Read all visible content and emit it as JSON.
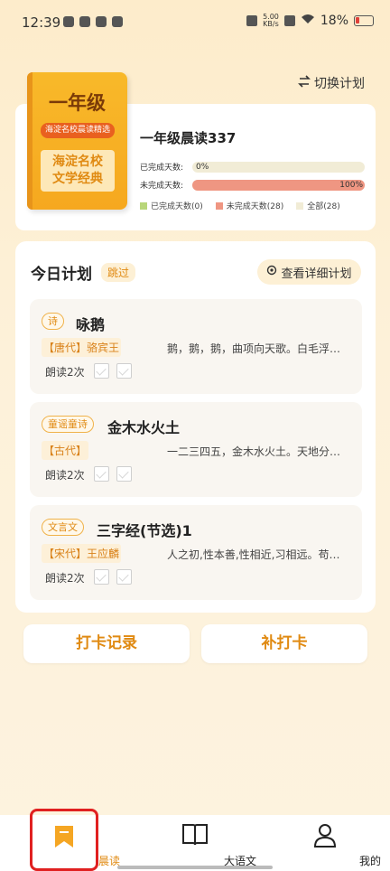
{
  "status_bar": {
    "time": "12:39",
    "speed_top": "5.00",
    "speed_bottom": "KB/s",
    "battery": "18%"
  },
  "header": {
    "switch_plan": "切换计划"
  },
  "plan": {
    "cover_title": "一年级",
    "cover_badge": "海淀名校晨读精选",
    "cover_line1": "海淀名校",
    "cover_line2": "文学经典",
    "title": "一年级晨读337",
    "completed_label": "已完成天数:",
    "completed_value": "0%",
    "completed_fraction": 0,
    "uncompleted_label": "未完成天数:",
    "uncompleted_value": "100%",
    "uncompleted_fraction": 1.0,
    "legend": [
      {
        "label": "已完成天数(0)",
        "color": "#b8d67a"
      },
      {
        "label": "未完成天数(28)",
        "color": "#ef9682"
      },
      {
        "label": "全部(28)",
        "color": "#f1ecd6"
      }
    ]
  },
  "today": {
    "title": "今日计划",
    "skip": "跳过",
    "detail": "查看详细计划",
    "read_label": "朗读2次",
    "items": [
      {
        "tag": "诗",
        "title": "咏鹅",
        "author": "【唐代】骆宾王",
        "excerpt": "鹅，鹅，鹅，曲项向天歌。白毛浮绿水，红掌拨清波。"
      },
      {
        "tag": "童谣童诗",
        "title": "金木水火土",
        "author": "【古代】",
        "excerpt": "一二三四五，金木水火土。天地分上下，日月照今古。"
      },
      {
        "tag": "文言文",
        "title": "三字经(节选)1",
        "author": "【宋代】王应麟",
        "excerpt": "人之初,性本善,性相近,习相远。苟不教,性乃迁。"
      }
    ]
  },
  "actions": {
    "checkin_record": "打卡记录",
    "makeup_checkin": "补打卡"
  },
  "nav": {
    "morning": "晨读",
    "chinese": "大语文",
    "mine": "我的"
  }
}
